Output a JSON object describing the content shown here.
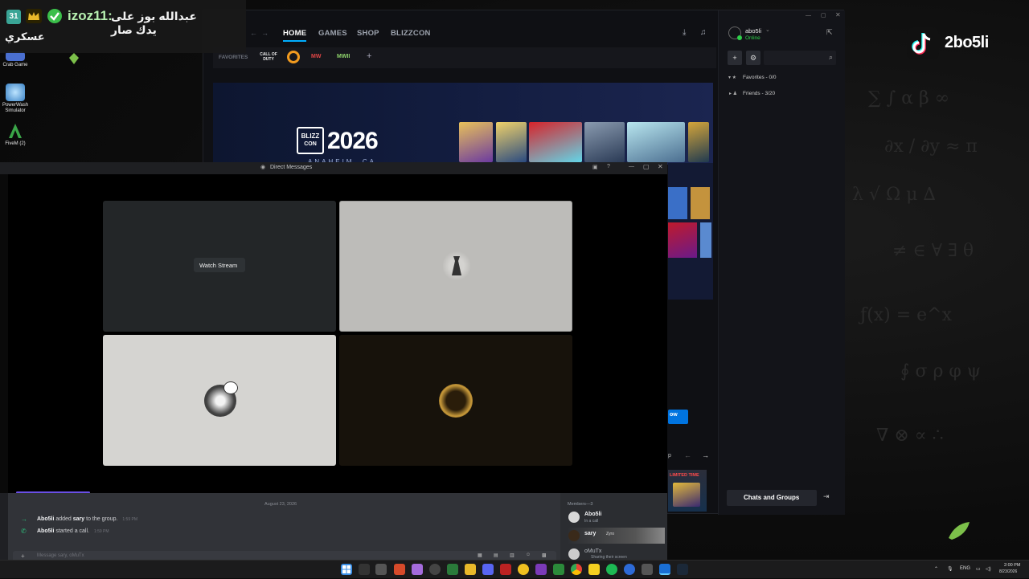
{
  "desktop": {
    "icons": [
      {
        "label": "Crab Game",
        "color": "#4a6fd0"
      },
      {
        "label": "PowerWash Simulator",
        "color": "#5aa6e8"
      },
      {
        "label": "FiveM (2)",
        "color": "#3aa548"
      }
    ]
  },
  "chat_overlay": {
    "badge_number": "31",
    "username": "izoz11:",
    "message_line1": "عبدالله بوز على يدك صار",
    "message_line2": "عسكري",
    "colors": {
      "username": "#b6f0b0",
      "badge": "#3aa596",
      "crown": "#e8b82a",
      "verified": "#3bbf4a"
    }
  },
  "watermark": {
    "handle": "2bo5li",
    "icon": "tiktok-icon"
  },
  "battlenet": {
    "nav": {
      "home": "HOME",
      "games": "GAMES",
      "shop": "SHOP",
      "blizzcon": "BLIZZCON"
    },
    "favorites_label": "FAVORITES",
    "favorite_games": [
      "CALL OF DUTY",
      "OW",
      "MW",
      "MWII"
    ],
    "banner": {
      "logo_top": "BLIZZ",
      "logo_bottom": "CON",
      "year": "2026",
      "location": "ANAHEIM, CA"
    },
    "profile": {
      "name": "abo5li",
      "status": "Online"
    },
    "sections": {
      "favorites": "Favorites - 0/0",
      "friends": "Friends - 3/20"
    },
    "chats_button": "Chats and Groups",
    "promo_badge": "LIMITED TIME",
    "partial_button": "ow",
    "partial_link": "p"
  },
  "discord": {
    "title": "Direct Messages",
    "tiles": {
      "watch_stream": "Watch Stream"
    },
    "date_divider": "August 23, 2026",
    "messages": [
      {
        "user": "Abo5li",
        "text": "added",
        "target": "sary",
        "suffix": "to the group.",
        "time": "1:59 PM",
        "icon": "arrow-right-icon"
      },
      {
        "user": "Abo5li",
        "text": "started a call.",
        "target": "",
        "suffix": "",
        "time": "1:59 PM",
        "icon": "phone-icon"
      }
    ],
    "input_placeholder": "Message sary, oMuTx",
    "members": {
      "header": "Members—3",
      "list": [
        {
          "name": "Abo5li",
          "status": "In a call"
        },
        {
          "name": "sary",
          "status": "Zyro"
        },
        {
          "name": "oMuTx",
          "status": "Sharing their screen"
        }
      ]
    }
  },
  "taskbar": {
    "language": "ENG",
    "time": "2:00 PM",
    "date": "8/23/2026"
  }
}
